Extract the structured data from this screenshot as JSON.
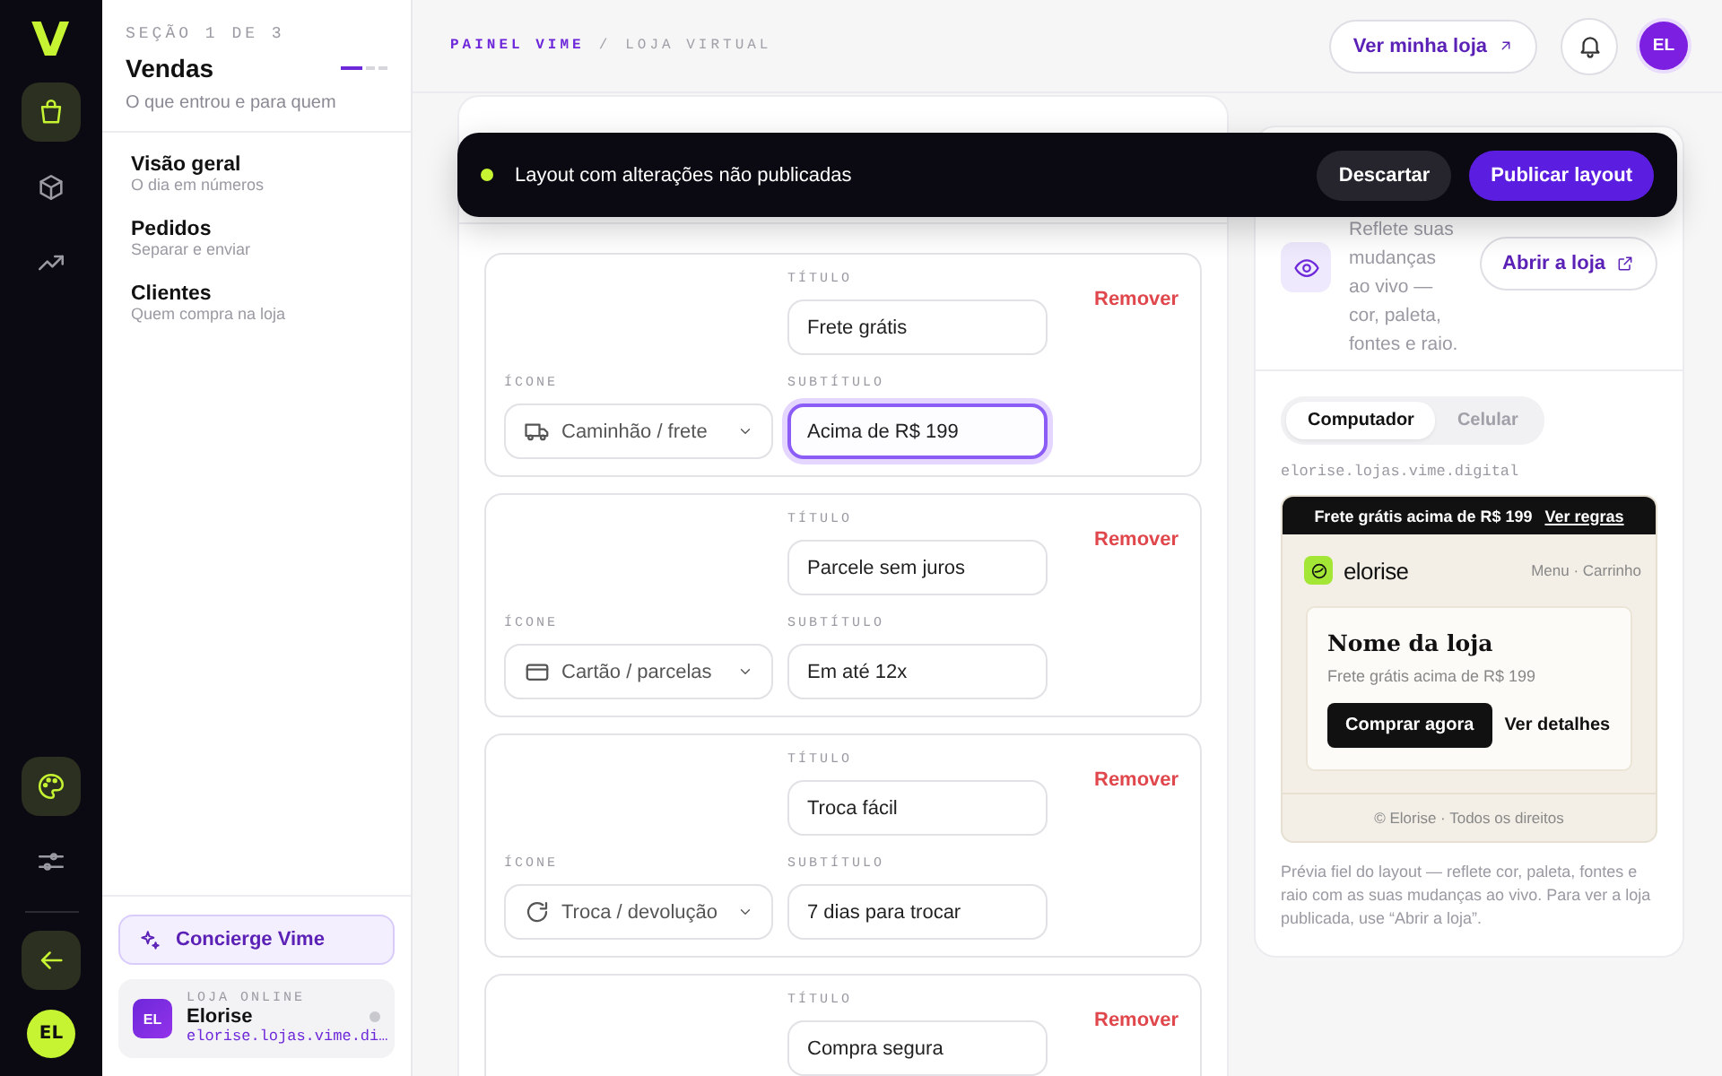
{
  "rail": {
    "logo": "V",
    "items": [
      {
        "kind": "bag",
        "selected": true
      },
      {
        "kind": "box",
        "selected": false
      },
      {
        "kind": "trend",
        "selected": false
      }
    ],
    "bottom_items": [
      {
        "kind": "palette",
        "selected": true
      },
      {
        "kind": "sliders",
        "selected": false
      }
    ],
    "avatar": "EL"
  },
  "sidebar": {
    "eyebrow": "SEÇÃO 1 DE 3",
    "title": "Vendas",
    "steps": [
      {
        "selected": true
      },
      {
        "selected": false
      },
      {
        "selected": false
      }
    ],
    "subtitle": "O que entrou e para quem",
    "items": [
      {
        "label": "Visão geral",
        "hint": "O dia em números"
      },
      {
        "label": "Pedidos",
        "hint": "Separar e enviar"
      },
      {
        "label": "Clientes",
        "hint": "Quem compra na loja"
      }
    ],
    "concierge": "Concierge Vime",
    "store": {
      "avatar": "EL",
      "eyebrow": "LOJA ONLINE",
      "name": "Elorise",
      "url": "elorise.lojas.vime.di…",
      "online": false
    }
  },
  "header": {
    "breadcrumb": [
      "PAINEL VIME",
      "LOJA VIRTUAL"
    ],
    "separator": "/",
    "store_button": "Ver minha loja",
    "avatar": "EL"
  },
  "editor": {
    "items": [
      {
        "title_label": "TÍTULO",
        "title": "Frete grátis",
        "icon_label": "ÍCONE",
        "icon": {
          "kind": "truck",
          "label": "Caminhão / frete"
        },
        "subtitle_label": "SUBTÍTULO",
        "subtitle": "Acima de R$ 199",
        "focused": true,
        "remove": "Remover"
      },
      {
        "title_label": "TÍTULO",
        "title": "Parcele sem juros",
        "icon_label": "ÍCONE",
        "icon": {
          "kind": "card",
          "label": "Cartão / parcelas"
        },
        "subtitle_label": "SUBTÍTULO",
        "subtitle": "Em até 12x",
        "focused": false,
        "remove": "Remover"
      },
      {
        "title_label": "TÍTULO",
        "title": "Troca fácil",
        "icon_label": "ÍCONE",
        "icon": {
          "kind": "refresh",
          "label": "Troca / devolução"
        },
        "subtitle_label": "SUBTÍTULO",
        "subtitle": "7 dias para trocar",
        "focused": false,
        "remove": "Remover"
      },
      {
        "title_label": "TÍTULO",
        "title": "Compra segura",
        "remove": "Remover"
      }
    ]
  },
  "toast": {
    "message": "Layout com alterações não publicadas",
    "discard": "Descartar",
    "publish": "Publicar layout"
  },
  "preview": {
    "description": "Reflete suas mudanças ao vivo — cor, paleta, fontes e raio.",
    "open_button": "Abrir a loja",
    "tabs": [
      {
        "label": "Computador",
        "selected": true
      },
      {
        "label": "Celular",
        "selected": false
      }
    ],
    "url": "elorise.lojas.vime.digital",
    "announcement": "Frete grátis acima de R$ 199",
    "announcement_link": "Ver regras",
    "brand": "elorise",
    "nav": "Menu · Carrinho",
    "hero_title": "Nome da loja",
    "hero_text": "Frete grátis acima de R$ 199",
    "primary_button": "Comprar agora",
    "secondary_button": "Ver detalhes",
    "footer": "© Elorise · Todos os direitos",
    "caption": "Prévia fiel do layout — reflete cor, paleta, fontes e raio com as suas mudanças ao vivo. Para ver a loja publicada, use “Abrir a loja”."
  }
}
